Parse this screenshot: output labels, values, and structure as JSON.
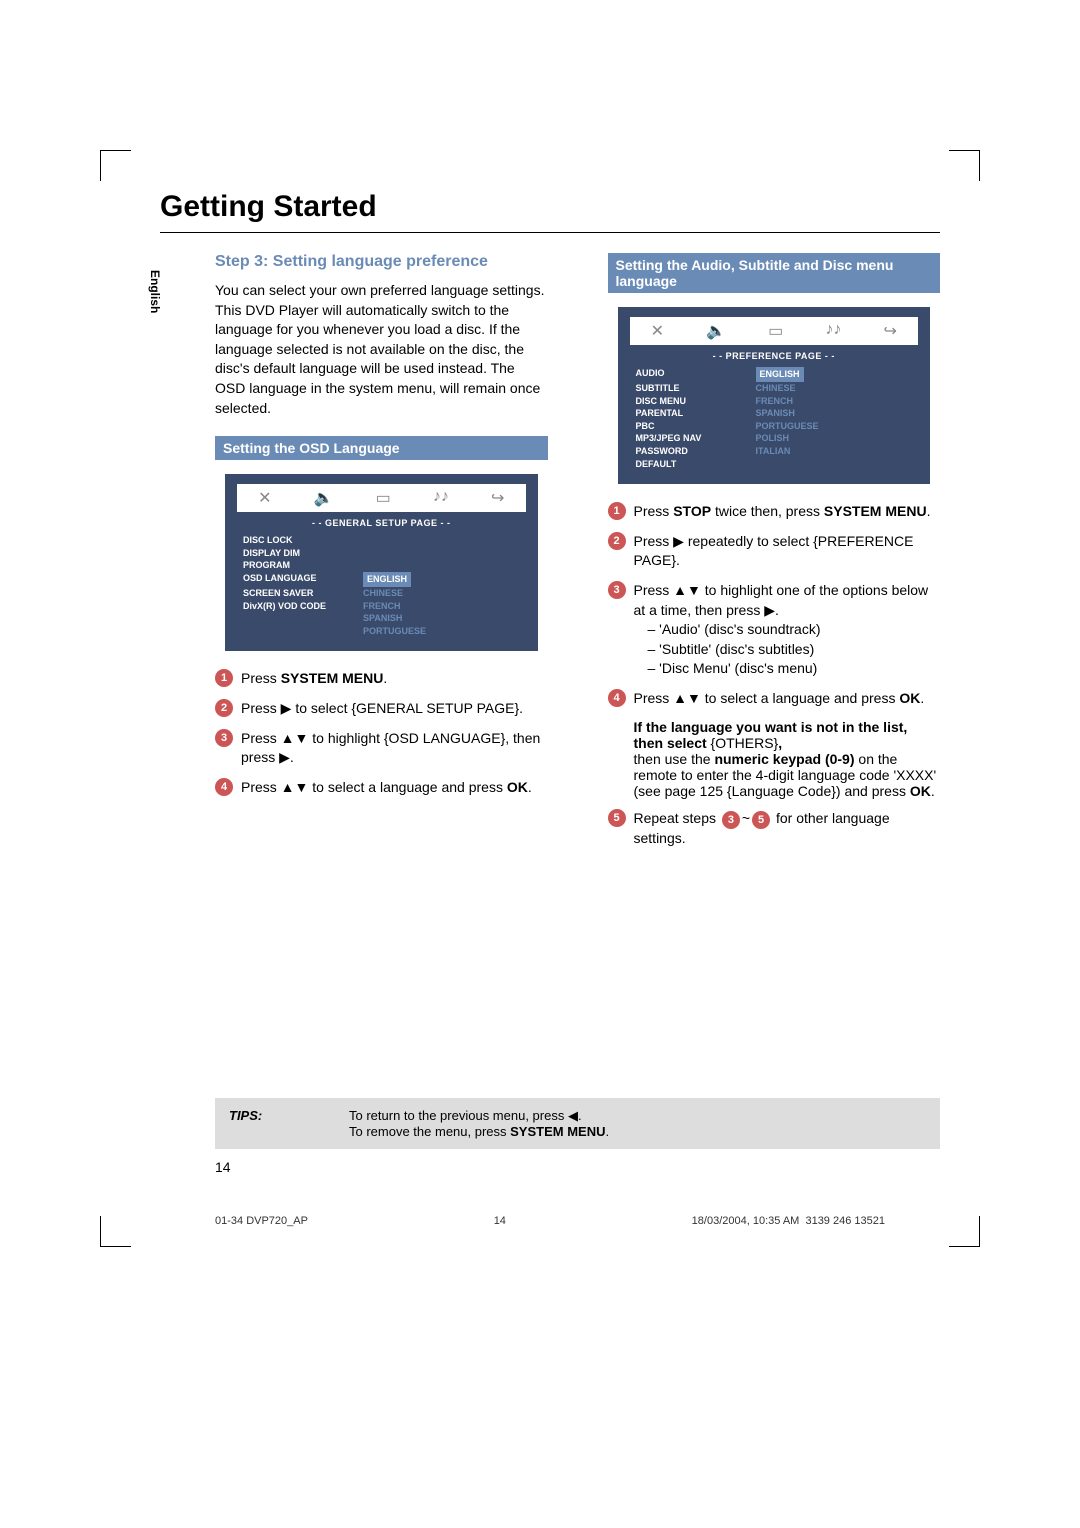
{
  "lang_tab": "English",
  "title": "Getting Started",
  "step3": {
    "heading": "Step 3:  Setting language preference",
    "intro": "You can select your own preferred language settings. This DVD Player will automatically switch to the language for you whenever you load a disc.  If the language selected is not available on the disc, the disc's default language will be used instead.  The OSD language in the system menu, will remain once selected."
  },
  "osd_section_header": "Setting the OSD Language",
  "osd_screen": {
    "title": "- -   GENERAL  SETUP  PAGE   - -",
    "items": [
      {
        "key": "DISC LOCK",
        "val": ""
      },
      {
        "key": "DISPLAY DIM",
        "val": ""
      },
      {
        "key": "PROGRAM",
        "val": ""
      },
      {
        "key": "OSD LANGUAGE",
        "val": "ENGLISH",
        "hl": true
      },
      {
        "key": "SCREEN SAVER",
        "val": "CHINESE"
      },
      {
        "key": "DivX(R) VOD CODE",
        "val": "FRENCH"
      },
      {
        "key": "",
        "val": "SPANISH"
      },
      {
        "key": "",
        "val": "PORTUGUESE"
      }
    ]
  },
  "osd_steps": {
    "s1_a": "Press ",
    "s1_b": "SYSTEM MENU",
    "s1_c": ".",
    "s2": "Press ▶ to select {GENERAL SETUP PAGE}.",
    "s3": "Press ▲▼ to highlight {OSD LANGUAGE}, then press ▶.",
    "s4_a": "Press ▲▼  to select a language and press ",
    "s4_b": "OK",
    "s4_c": "."
  },
  "pref_section_header": "Setting the Audio, Subtitle and Disc menu language",
  "pref_screen": {
    "title": "- -   PREFERENCE  PAGE   - -",
    "items": [
      {
        "key": "AUDIO",
        "val": "ENGLISH",
        "hl": true
      },
      {
        "key": "SUBTITLE",
        "val": "CHINESE"
      },
      {
        "key": "DISC MENU",
        "val": "FRENCH"
      },
      {
        "key": "PARENTAL",
        "val": "SPANISH"
      },
      {
        "key": "PBC",
        "val": "PORTUGUESE"
      },
      {
        "key": "MP3/JPEG NAV",
        "val": "POLISH"
      },
      {
        "key": "PASSWORD",
        "val": "ITALIAN"
      },
      {
        "key": "DEFAULT",
        "val": ""
      }
    ]
  },
  "pref_steps": {
    "s1_a": "Press ",
    "s1_b": "STOP",
    "s1_c": " twice then, press ",
    "s1_d": "SYSTEM MENU",
    "s1_e": ".",
    "s2": "Press ▶ repeatedly to select {PREFERENCE PAGE}.",
    "s3": "Press ▲▼  to highlight one of the options below at a time, then press ▶.",
    "s3a": "– 'Audio' (disc's soundtrack)",
    "s3b": "– 'Subtitle' (disc's subtitles)",
    "s3c": "– 'Disc Menu' (disc's menu)",
    "s4_a": "Press ▲▼  to select a language and press ",
    "s4_b": "OK",
    "s4_c": ".",
    "note1": "If the language you want is not in the list, then select ",
    "note1b": "{OTHERS}",
    "note1c": ",",
    "note2a": "then use the ",
    "note2b": "numeric keypad (0-9)",
    "note2c": " on the remote to enter the 4-digit language code 'XXXX' (see page 125 {Language Code}) and press ",
    "note2d": "OK",
    "note2e": ".",
    "s5_a": "Repeat steps ",
    "s5_b": "~",
    "s5_c": " for other language settings."
  },
  "tips": {
    "label": "TIPS:",
    "line1a": "To return to the previous menu, press ◀.",
    "line2a": "To remove the menu, press ",
    "line2b": "SYSTEM MENU",
    "line2c": "."
  },
  "pagenum": "14",
  "footer": {
    "left": "01-34 DVP720_AP",
    "center": "14",
    "right_a": "18/03/2004, 10:35 AM",
    "right_b": "3139 246 13521"
  },
  "icons": {
    "wrench": "✕",
    "speaker": "🔈",
    "tv": "▭",
    "eq": "♪♪",
    "exit": "↪"
  }
}
